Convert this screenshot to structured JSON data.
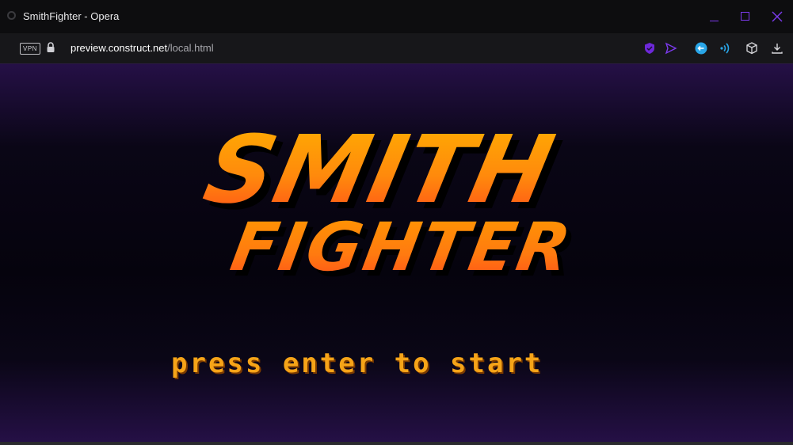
{
  "window": {
    "title": "SmithFighter - Opera",
    "minimize_icon": "minimize-icon",
    "maximize_icon": "maximize-icon",
    "close_icon": "close-icon",
    "accent": "#7c3aed"
  },
  "addressbar": {
    "vpn_label": "VPN",
    "url_domain": "preview.construct.net",
    "url_path": "/local.html",
    "icons": [
      "lock-icon",
      "shield-icon",
      "send-icon",
      "back-bubble-icon",
      "wireless-icon",
      "cube-icon",
      "download-icon"
    ]
  },
  "game": {
    "logo_line1": "SMITH",
    "logo_line2": "FIGHTER",
    "prompt": "press enter to start",
    "colors": {
      "logo_top": "#ffb000",
      "logo_bottom": "#ff4a1a",
      "prompt": "#f6a418",
      "bg_edge": "#251046",
      "bg_center": "#05030d"
    }
  }
}
